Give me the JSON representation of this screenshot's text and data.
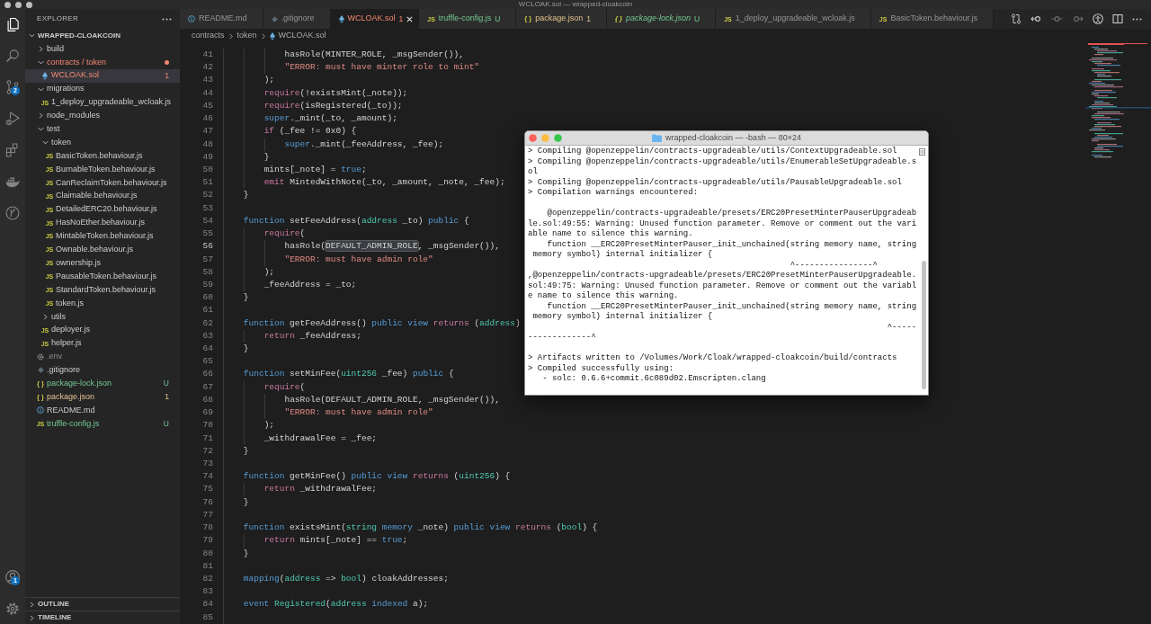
{
  "window": {
    "title": "WCLOAK.sol — wrapped-cloakcoin"
  },
  "activity_bar": {
    "items": [
      {
        "kind": "explorer",
        "selected": true
      },
      {
        "kind": "search",
        "selected": false
      },
      {
        "kind": "source_control",
        "selected": false,
        "badge": "2"
      },
      {
        "kind": "run_debug",
        "selected": false
      },
      {
        "kind": "extensions",
        "selected": false
      },
      {
        "kind": "docker",
        "selected": false
      },
      {
        "kind": "git_graph",
        "selected": false
      }
    ],
    "bottom_items": [
      {
        "kind": "accounts",
        "badge": "1"
      },
      {
        "kind": "manage"
      }
    ]
  },
  "sidebar": {
    "title": "EXPLORER",
    "root": {
      "label": "WRAPPED-CLOAKCOIN",
      "expanded": true
    },
    "tree": [
      {
        "label": "build",
        "kind": "folder",
        "expanded": false,
        "selected": false
      },
      {
        "label": "contracts / token",
        "kind": "folder",
        "expanded": true,
        "selected": false,
        "has_errors": true,
        "dot": true,
        "children": [
          {
            "label": "WCLOAK.sol",
            "kind": "sol",
            "selected": true,
            "has_errors": true,
            "decoration": "1"
          }
        ]
      },
      {
        "label": "migrations",
        "kind": "folder",
        "expanded": true,
        "selected": false,
        "children": [
          {
            "label": "1_deploy_upgradeable_wcloak.js",
            "kind": "js",
            "icon": "JS",
            "selected": false
          }
        ]
      },
      {
        "label": "node_modules",
        "kind": "folder",
        "expanded": false,
        "selected": false
      },
      {
        "label": "test",
        "kind": "folder",
        "expanded": true,
        "selected": false,
        "children": [
          {
            "label": "token",
            "kind": "folder",
            "expanded": true,
            "selected": false,
            "children": [
              {
                "label": "BasicToken.behaviour.js",
                "kind": "js",
                "icon": "JS",
                "selected": false
              },
              {
                "label": "BurnableToken.behaviour.js",
                "kind": "js",
                "icon": "JS",
                "selected": false
              },
              {
                "label": "CanReclaimToken.behaviour.js",
                "kind": "js",
                "icon": "JS",
                "selected": false
              },
              {
                "label": "Claimable.behaviour.js",
                "kind": "js",
                "icon": "JS",
                "selected": false
              },
              {
                "label": "DetailedERC20.behaviour.js",
                "kind": "js",
                "icon": "JS",
                "selected": false
              },
              {
                "label": "HasNoEther.behaviour.js",
                "kind": "js",
                "icon": "JS",
                "selected": false
              },
              {
                "label": "MintableToken.behaviour.js",
                "kind": "js",
                "icon": "JS",
                "selected": false
              },
              {
                "label": "Ownable.behaviour.js",
                "kind": "js",
                "icon": "JS",
                "selected": false
              },
              {
                "label": "ownership.js",
                "kind": "js",
                "icon": "JS",
                "selected": false
              },
              {
                "label": "PausableToken.behaviour.js",
                "kind": "js",
                "icon": "JS",
                "selected": false
              },
              {
                "label": "StandardToken.behaviour.js",
                "kind": "js",
                "icon": "JS",
                "selected": false
              },
              {
                "label": "token.js",
                "kind": "js",
                "icon": "JS",
                "selected": false
              }
            ]
          },
          {
            "label": "utils",
            "kind": "folder",
            "expanded": false,
            "selected": false
          },
          {
            "label": "deployer.js",
            "kind": "js",
            "icon": "JS",
            "selected": false
          },
          {
            "label": "helper.js",
            "kind": "js",
            "icon": "JS",
            "selected": false
          }
        ]
      },
      {
        "label": ".env",
        "kind": "env",
        "selected": false,
        "ignored": true
      },
      {
        "label": ".gitignore",
        "kind": "git",
        "selected": false
      },
      {
        "label": "package-lock.json",
        "kind": "json",
        "icon": "{ }",
        "selected": false,
        "untracked": true,
        "decoration": "U"
      },
      {
        "label": "package.json",
        "kind": "json",
        "icon": "{ }",
        "selected": false,
        "has_warnings": true,
        "decoration": "1"
      },
      {
        "label": "README.md",
        "kind": "readme",
        "selected": false
      },
      {
        "label": "truffle-config.js",
        "kind": "js",
        "icon": "JS",
        "selected": false,
        "untracked": true,
        "decoration": "U"
      }
    ],
    "sections": [
      {
        "label": "OUTLINE",
        "expanded": false
      },
      {
        "label": "TIMELINE",
        "expanded": false
      }
    ]
  },
  "tabs": [
    {
      "label": "README.md",
      "kind": "readme",
      "selected": false
    },
    {
      "label": ".gitignore",
      "kind": "git",
      "selected": false
    },
    {
      "label": "WCLOAK.sol",
      "kind": "sol",
      "selected": true,
      "has_errors": true,
      "decoration": "1"
    },
    {
      "label": "truffle-config.js",
      "kind": "js",
      "icon": "JS",
      "selected": false,
      "untracked": true,
      "decoration": "U"
    },
    {
      "label": "package.json",
      "kind": "json",
      "icon": "{ }",
      "selected": false,
      "has_warnings": true,
      "decoration": "1"
    },
    {
      "label": "package-lock.json",
      "kind": "json",
      "icon": "{ }",
      "selected": false,
      "untracked": true,
      "decoration": "U",
      "preview": true
    },
    {
      "label": "1_deploy_upgradeable_wcloak.js",
      "kind": "js",
      "icon": "JS",
      "selected": false
    },
    {
      "label": "BasicToken.behaviour.js",
      "kind": "js",
      "icon": "JS",
      "selected": false
    }
  ],
  "breadcrumbs": [
    {
      "label": "contracts",
      "kind": "folder"
    },
    {
      "label": "token",
      "kind": "folder"
    },
    {
      "label": "WCLOAK.sol",
      "kind": "sol"
    }
  ],
  "editor": {
    "lines": [
      {
        "number": "41",
        "current": false,
        "tokens": [
          {
            "text": "            hasRole(MINTER_ROLE, _msgSender()),",
            "kind": "plain"
          }
        ]
      },
      {
        "number": "42",
        "current": false,
        "tokens": [
          {
            "text": "            \"ERROR: must have minter role to mint\"",
            "kind": "string"
          }
        ]
      },
      {
        "number": "43",
        "current": false,
        "tokens": [
          {
            "text": "        );",
            "kind": "plain"
          }
        ]
      },
      {
        "number": "44",
        "current": false,
        "tokens": [
          {
            "text": "        require",
            "kind": "control"
          },
          {
            "text": "(!existsMint(_note));",
            "kind": "plain"
          }
        ]
      },
      {
        "number": "45",
        "current": false,
        "tokens": [
          {
            "text": "        require",
            "kind": "control"
          },
          {
            "text": "(isRegistered(_to));",
            "kind": "plain"
          }
        ]
      },
      {
        "number": "46",
        "current": false,
        "tokens": [
          {
            "text": "        super",
            "kind": "keyword"
          },
          {
            "text": "._mint(_to, _amount);",
            "kind": "plain"
          }
        ]
      },
      {
        "number": "47",
        "current": false,
        "tokens": [
          {
            "text": "        if",
            "kind": "control"
          },
          {
            "text": " (_fee != 0x0) {",
            "kind": "plain"
          }
        ]
      },
      {
        "number": "48",
        "current": false,
        "tokens": [
          {
            "text": "            super",
            "kind": "keyword"
          },
          {
            "text": "._mint(_feeAddress, _fee);",
            "kind": "plain"
          }
        ]
      },
      {
        "number": "49",
        "current": false,
        "tokens": [
          {
            "text": "        }",
            "kind": "plain"
          }
        ]
      },
      {
        "number": "50",
        "current": false,
        "tokens": [
          {
            "text": "        mints[_note] = ",
            "kind": "plain"
          },
          {
            "text": "true",
            "kind": "keyword"
          },
          {
            "text": ";",
            "kind": "plain"
          }
        ]
      },
      {
        "number": "51",
        "current": false,
        "tokens": [
          {
            "text": "        emit",
            "kind": "control"
          },
          {
            "text": " MintedWithNote(_to, _amount, _note, _fee);",
            "kind": "plain"
          }
        ]
      },
      {
        "number": "52",
        "current": false,
        "tokens": [
          {
            "text": "    }",
            "kind": "plain"
          }
        ]
      },
      {
        "number": "53",
        "current": false
      },
      {
        "number": "54",
        "current": false,
        "tokens": [
          {
            "text": "    function",
            "kind": "keyword"
          },
          {
            "text": " setFeeAddress(",
            "kind": "plain"
          },
          {
            "text": "address",
            "kind": "type"
          },
          {
            "text": " _to) ",
            "kind": "plain"
          },
          {
            "text": "public",
            "kind": "keyword"
          },
          {
            "text": " {",
            "kind": "plain"
          }
        ]
      },
      {
        "number": "55",
        "current": false,
        "tokens": [
          {
            "text": "        require",
            "kind": "control"
          },
          {
            "text": "(",
            "kind": "plain"
          }
        ]
      },
      {
        "number": "56",
        "current": true,
        "tokens": [
          {
            "text": "            hasRole(",
            "kind": "plain"
          },
          {
            "text": "DEFAULT_ADMIN_ROLE",
            "kind": "plain",
            "highlighted": true
          },
          {
            "text": ", _msgSender()),",
            "kind": "plain"
          }
        ]
      },
      {
        "number": "57",
        "current": false,
        "tokens": [
          {
            "text": "            \"ERROR: must have admin role\"",
            "kind": "string"
          }
        ]
      },
      {
        "number": "58",
        "current": false,
        "tokens": [
          {
            "text": "        );",
            "kind": "plain"
          }
        ]
      },
      {
        "number": "59",
        "current": false,
        "tokens": [
          {
            "text": "        _feeAddress = _to;",
            "kind": "plain"
          }
        ]
      },
      {
        "number": "60",
        "current": false,
        "tokens": [
          {
            "text": "    }",
            "kind": "plain"
          }
        ]
      },
      {
        "number": "61",
        "current": false
      },
      {
        "number": "62",
        "current": false,
        "tokens": [
          {
            "text": "    function",
            "kind": "keyword"
          },
          {
            "text": " getFeeAddress() ",
            "kind": "plain"
          },
          {
            "text": "public",
            "kind": "keyword"
          },
          {
            "text": " view",
            "kind": "keyword"
          },
          {
            "text": " returns",
            "kind": "control"
          },
          {
            "text": " (",
            "kind": "plain"
          },
          {
            "text": "address",
            "kind": "type"
          },
          {
            "text": ")",
            "kind": "plain"
          }
        ]
      },
      {
        "number": "63",
        "current": false,
        "tokens": [
          {
            "text": "        return",
            "kind": "control"
          },
          {
            "text": " _feeAddress;",
            "kind": "plain"
          }
        ]
      },
      {
        "number": "64",
        "current": false,
        "tokens": [
          {
            "text": "    }",
            "kind": "plain"
          }
        ]
      },
      {
        "number": "65",
        "current": false
      },
      {
        "number": "66",
        "current": false,
        "tokens": [
          {
            "text": "    function",
            "kind": "keyword"
          },
          {
            "text": " setMinFee(",
            "kind": "plain"
          },
          {
            "text": "uint256",
            "kind": "type"
          },
          {
            "text": " _fee) ",
            "kind": "plain"
          },
          {
            "text": "public",
            "kind": "keyword"
          },
          {
            "text": " {",
            "kind": "plain"
          }
        ]
      },
      {
        "number": "67",
        "current": false,
        "tokens": [
          {
            "text": "        require",
            "kind": "control"
          },
          {
            "text": "(",
            "kind": "plain"
          }
        ]
      },
      {
        "number": "68",
        "current": false,
        "tokens": [
          {
            "text": "            hasRole(DEFAULT_ADMIN_ROLE, _msgSender()),",
            "kind": "plain"
          }
        ]
      },
      {
        "number": "69",
        "current": false,
        "tokens": [
          {
            "text": "            \"ERROR: must have admin role\"",
            "kind": "string"
          }
        ]
      },
      {
        "number": "70",
        "current": false,
        "tokens": [
          {
            "text": "        );",
            "kind": "plain"
          }
        ]
      },
      {
        "number": "71",
        "current": false,
        "tokens": [
          {
            "text": "        _withdrawalFee = _fee;",
            "kind": "plain"
          }
        ]
      },
      {
        "number": "72",
        "current": false,
        "tokens": [
          {
            "text": "    }",
            "kind": "plain"
          }
        ]
      },
      {
        "number": "73",
        "current": false
      },
      {
        "number": "74",
        "current": false,
        "tokens": [
          {
            "text": "    function",
            "kind": "keyword"
          },
          {
            "text": " getMinFee() ",
            "kind": "plain"
          },
          {
            "text": "public",
            "kind": "keyword"
          },
          {
            "text": " view",
            "kind": "keyword"
          },
          {
            "text": " returns",
            "kind": "control"
          },
          {
            "text": " (",
            "kind": "plain"
          },
          {
            "text": "uint256",
            "kind": "type"
          },
          {
            "text": ") {",
            "kind": "plain"
          }
        ]
      },
      {
        "number": "75",
        "current": false,
        "tokens": [
          {
            "text": "        return",
            "kind": "control"
          },
          {
            "text": " _withdrawalFee;",
            "kind": "plain"
          }
        ]
      },
      {
        "number": "76",
        "current": false,
        "tokens": [
          {
            "text": "    }",
            "kind": "plain"
          }
        ]
      },
      {
        "number": "77",
        "current": false
      },
      {
        "number": "78",
        "current": false,
        "tokens": [
          {
            "text": "    function",
            "kind": "keyword"
          },
          {
            "text": " existsMint(",
            "kind": "plain"
          },
          {
            "text": "string",
            "kind": "type"
          },
          {
            "text": " memory",
            "kind": "keyword"
          },
          {
            "text": " _note) ",
            "kind": "plain"
          },
          {
            "text": "public",
            "kind": "keyword"
          },
          {
            "text": " view",
            "kind": "keyword"
          },
          {
            "text": " returns",
            "kind": "control"
          },
          {
            "text": " (",
            "kind": "plain"
          },
          {
            "text": "bool",
            "kind": "type"
          },
          {
            "text": ") {",
            "kind": "plain"
          }
        ]
      },
      {
        "number": "79",
        "current": false,
        "tokens": [
          {
            "text": "        return",
            "kind": "control"
          },
          {
            "text": " mints[_note] == ",
            "kind": "plain"
          },
          {
            "text": "true",
            "kind": "keyword"
          },
          {
            "text": ";",
            "kind": "plain"
          }
        ]
      },
      {
        "number": "80",
        "current": false,
        "tokens": [
          {
            "text": "    }",
            "kind": "plain"
          }
        ]
      },
      {
        "number": "81",
        "current": false
      },
      {
        "number": "82",
        "current": false,
        "tokens": [
          {
            "text": "    mapping",
            "kind": "keyword"
          },
          {
            "text": "(",
            "kind": "plain"
          },
          {
            "text": "address",
            "kind": "type"
          },
          {
            "text": " => ",
            "kind": "plain"
          },
          {
            "text": "bool",
            "kind": "type"
          },
          {
            "text": ") cloakAddresses;",
            "kind": "plain"
          }
        ]
      },
      {
        "number": "83",
        "current": false
      },
      {
        "number": "84",
        "current": false,
        "tokens": [
          {
            "text": "    event",
            "kind": "keyword"
          },
          {
            "text": " Registered",
            "kind": "type"
          },
          {
            "text": "(",
            "kind": "plain"
          },
          {
            "text": "address",
            "kind": "type"
          },
          {
            "text": " indexed",
            "kind": "keyword"
          },
          {
            "text": " a);",
            "kind": "plain"
          }
        ]
      },
      {
        "number": "85",
        "current": false
      }
    ]
  },
  "terminal": {
    "title": "wrapped-cloakcoin — -bash — 80×24",
    "blocks": [
      [
        "> Compiling @openzeppelin/contracts-upgradeable/utils/ContextUpgradeable.sol",
        "> Compiling @openzeppelin/contracts-upgradeable/utils/EnumerableSetUpgradeable.s",
        "ol",
        "> Compiling @openzeppelin/contracts-upgradeable/utils/PausableUpgradeable.sol",
        "> Compilation warnings encountered:"
      ],
      [
        "    @openzeppelin/contracts-upgradeable/presets/ERC20PresetMinterPauserUpgradeab",
        "le.sol:49:55: Warning: Unused function parameter. Remove or comment out the vari",
        "able name to silence this warning.",
        "    function __ERC20PresetMinterPauser_init_unchained(string memory name, string",
        " memory symbol) internal initializer {",
        "                                                      ^----------------^",
        ",@openzeppelin/contracts-upgradeable/presets/ERC20PresetMinterPauserUpgradeable.",
        "sol:49:75: Warning: Unused function parameter. Remove or comment out the variabl",
        "e name to silence this warning.",
        "    function __ERC20PresetMinterPauser_init_unchained(string memory name, string",
        " memory symbol) internal initializer {",
        "                                                                          ^-----",
        "-------------^"
      ],
      [
        "> Artifacts written to /Volumes/Work/Cloak/wrapped-cloakcoin/build/contracts",
        "> Compiled successfully using:",
        "   - solc: 0.6.6+commit.6c089d02.Emscripten.clang"
      ]
    ]
  }
}
